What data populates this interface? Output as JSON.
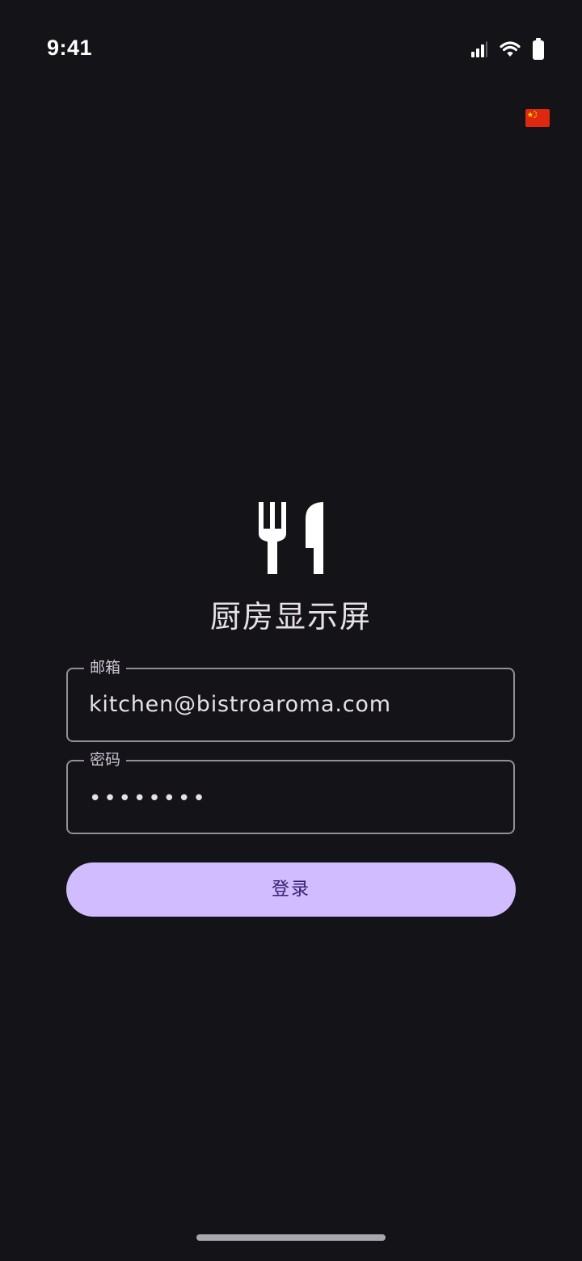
{
  "status_bar": {
    "time": "9:41",
    "icons": [
      "cellular-signal-icon",
      "wifi-icon",
      "battery-icon"
    ]
  },
  "language_selector": {
    "icon": "china-flag-icon"
  },
  "header": {
    "logo_icon": "fork-knife-icon",
    "title": "厨房显示屏"
  },
  "form": {
    "email": {
      "label": "邮箱",
      "value": "kitchen@bistroaroma.com"
    },
    "password": {
      "label": "密码",
      "masked_value": "••••••••"
    },
    "login_button": {
      "label": "登录"
    }
  },
  "colors": {
    "background": "#141318",
    "primary": "#d0bcff",
    "on_primary": "#381e72",
    "outline": "#938f99"
  }
}
